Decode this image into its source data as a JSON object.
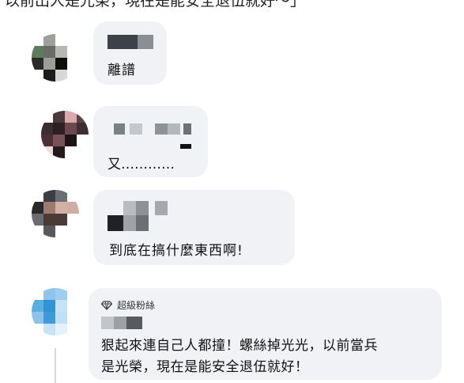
{
  "top_text": "以前出人是光榮，現在是能安全退伍就好～」",
  "comments": [
    {
      "message": "離譜"
    },
    {
      "message": "又…………"
    },
    {
      "message": "到底在搞什麼東西啊!"
    },
    {
      "badge": {
        "icon": "diamond-icon",
        "label": "超級粉絲"
      },
      "message_lines": [
        "狠起來連自己人都撞！螺絲掉光光，以前當兵",
        "是光榮，現在是能安全退伍就好！"
      ]
    }
  ],
  "colors": {
    "bubble": "#f0f2f5",
    "thread_line": "#d6d9de"
  }
}
